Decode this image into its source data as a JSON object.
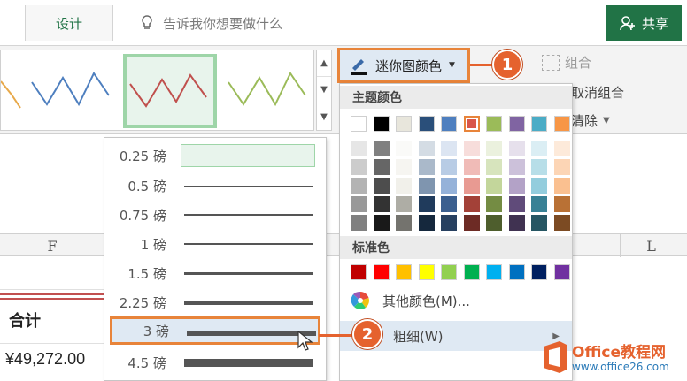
{
  "ribbon": {
    "tab_design": "设计",
    "tellme_placeholder": "告诉我你想要做什么",
    "share_label": "共享",
    "color_button_label": "迷你图颜色",
    "group_label": "组合",
    "ungroup_label": "取消组合",
    "clear_label": "清除"
  },
  "weight_menu": {
    "items": [
      {
        "label": "0.25 磅",
        "weight": 0.25
      },
      {
        "label": "0.5 磅",
        "weight": 0.5
      },
      {
        "label": "0.75 磅",
        "weight": 0.75
      },
      {
        "label": "1 磅",
        "weight": 1
      },
      {
        "label": "1.5 磅",
        "weight": 1.5
      },
      {
        "label": "2.25 磅",
        "weight": 2.25
      },
      {
        "label": "3 磅",
        "weight": 3
      },
      {
        "label": "4.5 磅",
        "weight": 4.5
      }
    ]
  },
  "color_menu": {
    "theme_colors_title": "主题颜色",
    "standard_colors_title": "标准色",
    "more_colors_label": "其他颜色(M)...",
    "weight_label": "粗细(W)",
    "theme_colors": [
      "#ffffff",
      "#000000",
      "#e8e6dc",
      "#2a4f7a",
      "#4e7fbf",
      "#d9564a",
      "#9bbb59",
      "#8064a2",
      "#4bacc6",
      "#f79646"
    ],
    "standard_colors": [
      "#c00000",
      "#ff0000",
      "#ffc000",
      "#ffff00",
      "#92d050",
      "#00b050",
      "#00b0f0",
      "#0070c0",
      "#002060",
      "#7030a0"
    ]
  },
  "sheet": {
    "col_F": "F",
    "col_L": "L",
    "total_label": "合计",
    "total_value": "¥49,272.00"
  },
  "callouts": {
    "one": "1",
    "two": "2"
  },
  "watermark": {
    "brand": "Office教程网",
    "url": "www.office26.com"
  }
}
